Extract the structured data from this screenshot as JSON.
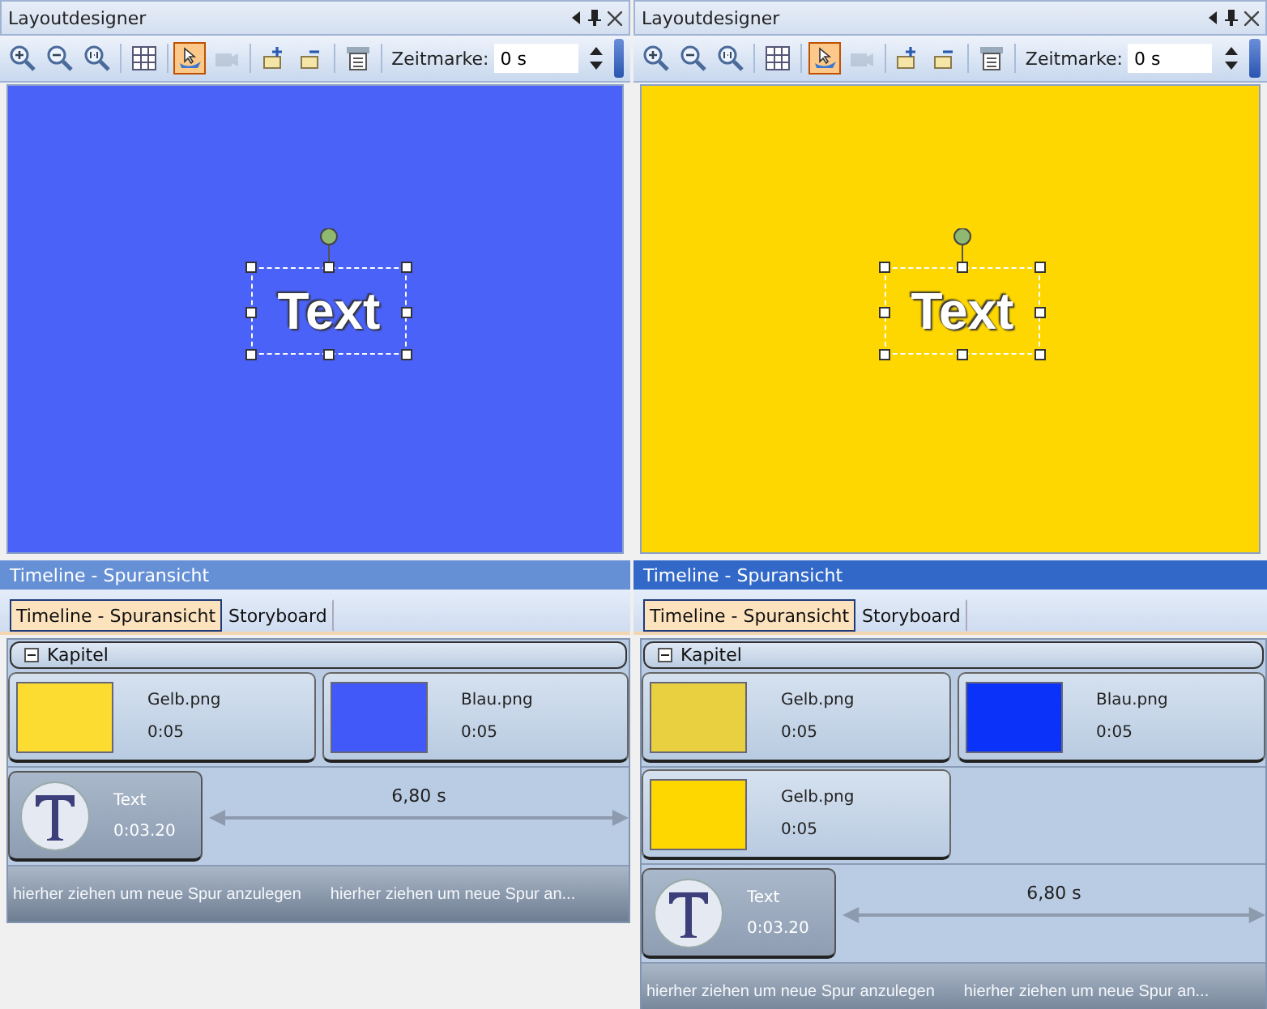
{
  "panels": [
    {
      "designer": {
        "title": "Layoutdesigner",
        "tools": [
          {
            "kind": "zoom-in",
            "selected": false,
            "disabled": false
          },
          {
            "kind": "zoom-out",
            "selected": false,
            "disabled": false
          },
          {
            "kind": "zoom-reset",
            "selected": false,
            "disabled": false
          },
          {
            "kind": "grid",
            "selected": false,
            "disabled": false
          },
          {
            "kind": "select",
            "selected": true,
            "disabled": false
          },
          {
            "kind": "camera",
            "selected": false,
            "disabled": true
          },
          {
            "kind": "layer-up",
            "selected": false,
            "disabled": false
          },
          {
            "kind": "layer-down",
            "selected": false,
            "disabled": false
          },
          {
            "kind": "properties",
            "selected": false,
            "disabled": false
          }
        ],
        "time_label": "Zeitmarke:",
        "time_value": "0 s",
        "color": "#4a62f8",
        "object_text": "Text"
      },
      "timeline": {
        "title": "Timeline - Spuransicht",
        "active": false,
        "tabs": [
          {
            "label": "Timeline - Spuransicht",
            "selected": true
          },
          {
            "label": "Storyboard",
            "selected": false
          }
        ],
        "chapter": {
          "label": "Kapitel",
          "expanded": true
        },
        "tracks": [
          {
            "kind": "clips",
            "clips": [
              {
                "name": "Gelb.png",
                "duration": "0:05",
                "color": "#fcdc30"
              },
              {
                "name": "Blau.png",
                "duration": "0:05",
                "color": "#4059f8"
              }
            ]
          },
          {
            "kind": "text",
            "name": "Text",
            "duration": "0:03.20",
            "span": "6,80 s"
          }
        ],
        "drop_hints": [
          "hierher ziehen um neue Spur anzulegen",
          "hierher ziehen um neue Spur an..."
        ]
      }
    },
    {
      "designer": {
        "title": "Layoutdesigner",
        "tools": [
          {
            "kind": "zoom-in",
            "selected": false,
            "disabled": false
          },
          {
            "kind": "zoom-out",
            "selected": false,
            "disabled": false
          },
          {
            "kind": "zoom-reset",
            "selected": false,
            "disabled": false
          },
          {
            "kind": "grid",
            "selected": false,
            "disabled": false
          },
          {
            "kind": "select",
            "selected": true,
            "disabled": false
          },
          {
            "kind": "camera",
            "selected": false,
            "disabled": true
          },
          {
            "kind": "layer-up",
            "selected": false,
            "disabled": false
          },
          {
            "kind": "layer-down",
            "selected": false,
            "disabled": false
          },
          {
            "kind": "properties",
            "selected": false,
            "disabled": false
          }
        ],
        "time_label": "Zeitmarke:",
        "time_value": "0 s",
        "color": "#ffd700",
        "object_text": "Text"
      },
      "timeline": {
        "title": "Timeline - Spuransicht",
        "active": true,
        "tabs": [
          {
            "label": "Timeline - Spuransicht",
            "selected": true
          },
          {
            "label": "Storyboard",
            "selected": false
          }
        ],
        "chapter": {
          "label": "Kapitel",
          "expanded": true
        },
        "tracks": [
          {
            "kind": "clips",
            "clips": [
              {
                "name": "Gelb.png",
                "duration": "0:05",
                "color": "#e8d040"
              },
              {
                "name": "Blau.png",
                "duration": "0:05",
                "color": "#0a32f8"
              }
            ]
          },
          {
            "kind": "clips",
            "clips": [
              {
                "name": "Gelb.png",
                "duration": "0:05",
                "color": "#ffd700"
              }
            ]
          },
          {
            "kind": "text",
            "name": "Text",
            "duration": "0:03.20",
            "span": "6,80 s"
          }
        ],
        "drop_hints": [
          "hierher ziehen um neue Spur anzulegen",
          "hierher ziehen um neue Spur an..."
        ]
      }
    }
  ]
}
